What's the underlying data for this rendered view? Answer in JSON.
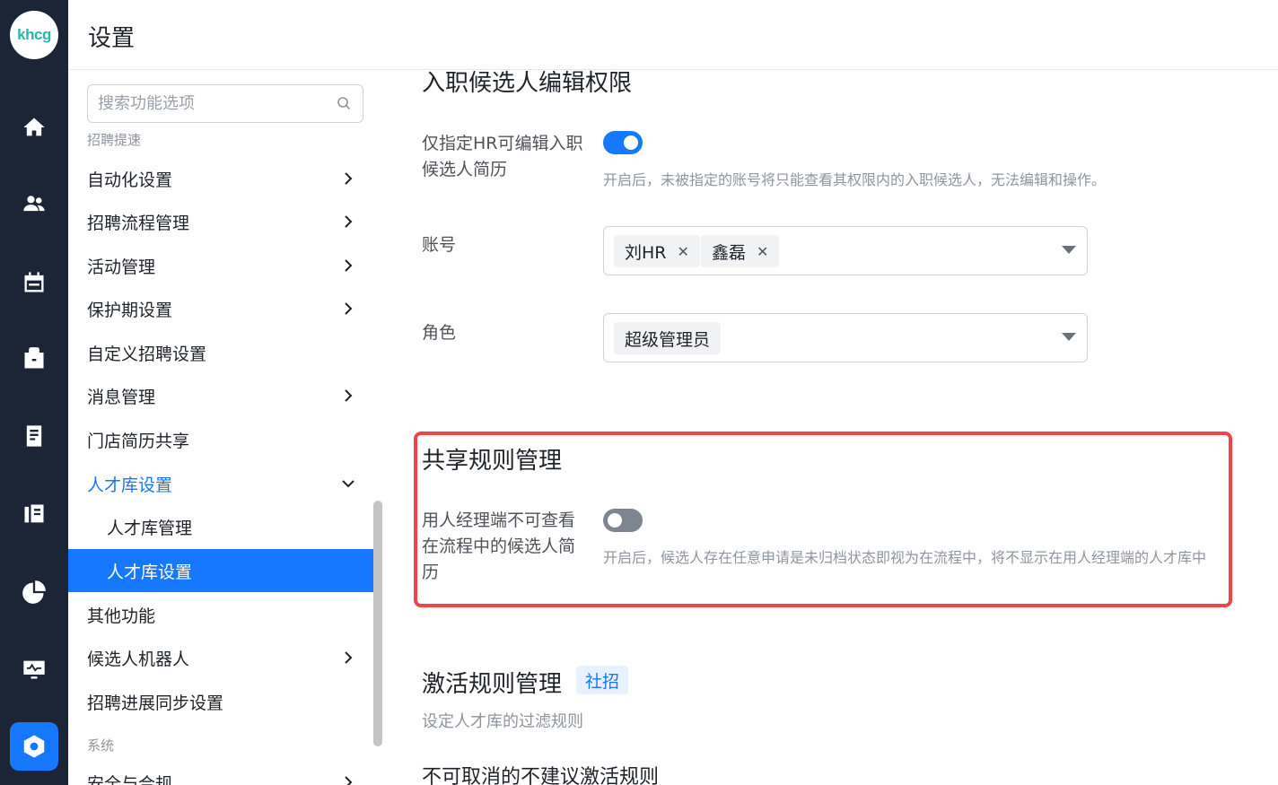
{
  "app": {
    "logo_text": "khcg"
  },
  "rail": {
    "icons": [
      "home-icon",
      "users-icon",
      "calendar-icon",
      "briefcase-icon",
      "book-icon",
      "library-icon",
      "pie-chart-icon",
      "monitor-icon",
      "settings-icon"
    ],
    "active": "settings-icon"
  },
  "header": {
    "title": "设置"
  },
  "sidebar": {
    "search_placeholder": "搜索功能选项",
    "group_recruit": "招聘提速",
    "items": [
      {
        "label": "自动化设置",
        "has_chevron": true
      },
      {
        "label": "招聘流程管理",
        "has_chevron": true
      },
      {
        "label": "活动管理",
        "has_chevron": true
      },
      {
        "label": "保护期设置",
        "has_chevron": true
      },
      {
        "label": "自定义招聘设置",
        "has_chevron": false
      },
      {
        "label": "消息管理",
        "has_chevron": true
      },
      {
        "label": "门店简历共享",
        "has_chevron": false
      },
      {
        "label": "人才库设置",
        "expanded": true
      },
      {
        "label": "人才库管理",
        "sub": true
      },
      {
        "label": "人才库设置",
        "sub": true,
        "selected": true
      },
      {
        "label": "其他功能",
        "has_chevron": false
      },
      {
        "label": "候选人机器人",
        "has_chevron": true
      },
      {
        "label": "招聘进展同步设置",
        "has_chevron": false
      }
    ],
    "group_system": "系统",
    "next_item": "安全与合规"
  },
  "main": {
    "onboard_section": {
      "title": "入职候选人编辑权限",
      "toggle_label": "仅指定HR可编辑入职候选人简历",
      "toggle_on": true,
      "hint": "开启后，未被指定的账号将只能查看其权限内的入职候选人，无法编辑和操作。",
      "account_label": "账号",
      "accounts": [
        "刘HR",
        "鑫磊"
      ],
      "role_label": "角色",
      "roles": [
        "超级管理员"
      ]
    },
    "share_section": {
      "title": "共享规则管理",
      "toggle_label": "用人经理端不可查看在流程中的候选人简历",
      "toggle_on": false,
      "hint": "开启后，候选人存在任意申请是未归档状态即视为在流程中，将不显示在用人经理端的人才库中"
    },
    "activate_section": {
      "title": "激活规则管理",
      "badge": "社招",
      "description": "设定人才库的过滤规则",
      "sub_title": "不可取消的不建议激活规则"
    },
    "colors": {
      "accent": "#1677ff",
      "highlight": "#f04545",
      "rail_bg": "#1b2536"
    }
  }
}
